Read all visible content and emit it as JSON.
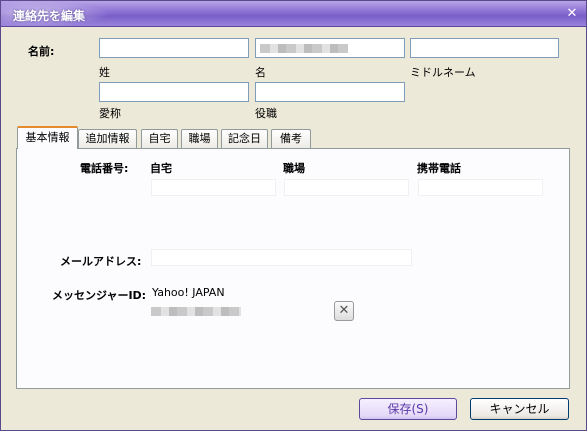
{
  "window": {
    "title": "連絡先を編集",
    "close_glyph": "✕"
  },
  "name_section": {
    "label": "名前:",
    "fields": [
      {
        "name": "last-name",
        "label": "姓",
        "value": ""
      },
      {
        "name": "first-name",
        "label": "名",
        "value": ""
      },
      {
        "name": "middle-name",
        "label": "ミドルネーム",
        "value": ""
      },
      {
        "name": "nickname",
        "label": "愛称",
        "value": ""
      },
      {
        "name": "title",
        "label": "役職",
        "value": ""
      }
    ]
  },
  "tabs": [
    {
      "label": "基本情報",
      "active": true
    },
    {
      "label": "追加情報",
      "active": false
    },
    {
      "label": "自宅",
      "active": false
    },
    {
      "label": "職場",
      "active": false
    },
    {
      "label": "記念日",
      "active": false
    },
    {
      "label": "備考",
      "active": false
    }
  ],
  "basic": {
    "phone_label": "電話番号:",
    "phone_columns": [
      "自宅",
      "職場",
      "携帯電話"
    ],
    "phone_values": [
      "",
      "",
      ""
    ],
    "email_label": "メールアドレス:",
    "email_value": "",
    "messenger_label": "メッセンジャーID:",
    "messenger_service": "Yahoo! JAPAN",
    "remove_glyph": "✕"
  },
  "buttons": {
    "save": "保存(S)",
    "cancel": "キャンセル"
  },
  "colors": {
    "title_bar": "#8f74d6",
    "tab_highlight": "#e68b2c",
    "save_text": "#5a3aa8"
  }
}
